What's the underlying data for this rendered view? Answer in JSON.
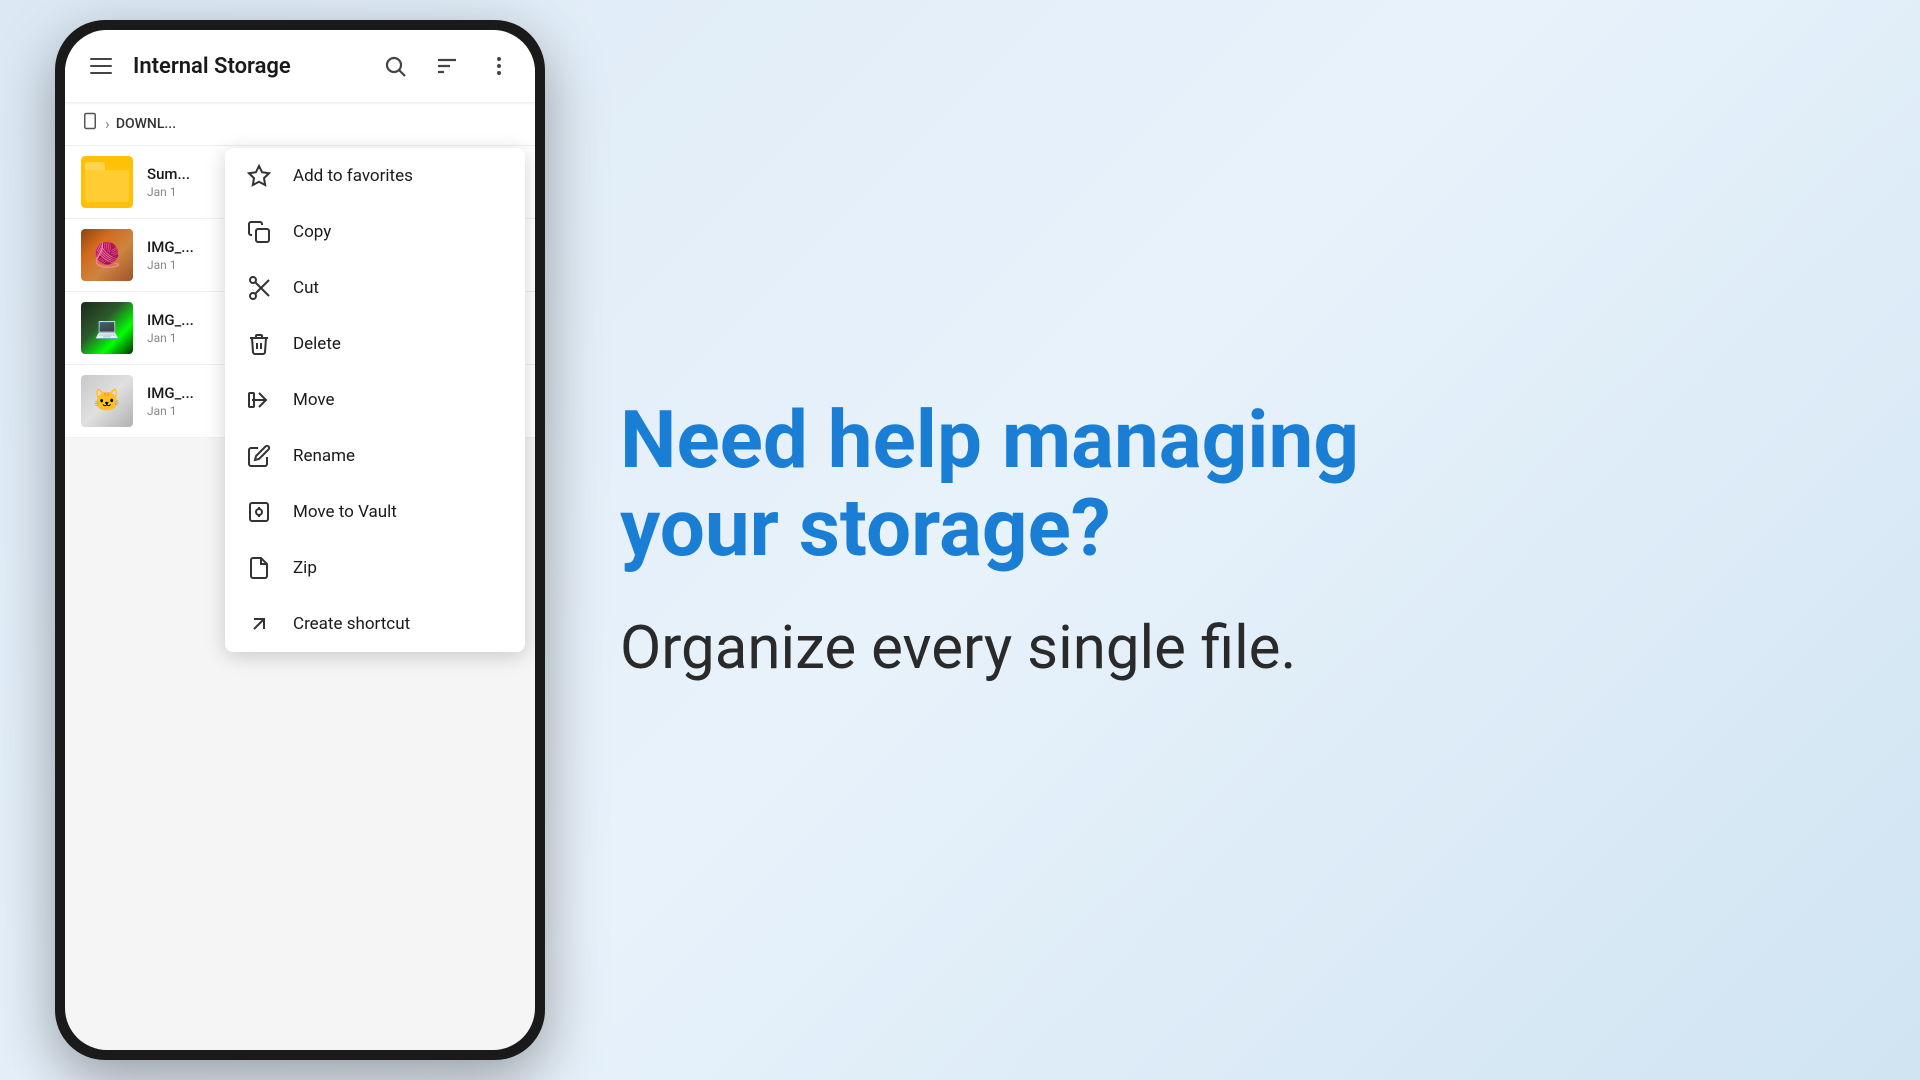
{
  "app": {
    "title": "Internal Storage",
    "breadcrumb": {
      "icon": "phone-icon",
      "separator": "›",
      "path": "DOWNL..."
    }
  },
  "toolbar": {
    "menu_icon": "hamburger-icon",
    "search_icon": "search-icon",
    "sort_icon": "sort-icon",
    "more_icon": "more-icon"
  },
  "files": [
    {
      "name": "Sum...",
      "date": "Jan 1",
      "type": "folder"
    },
    {
      "name": "IMG_...",
      "date": "Jan 1",
      "type": "image1"
    },
    {
      "name": "IMG_...",
      "date": "Jan 1",
      "type": "image2"
    },
    {
      "name": "IMG_...",
      "date": "Jan 1",
      "type": "image3"
    }
  ],
  "context_menu": {
    "items": [
      {
        "id": "add-favorites",
        "label": "Add to favorites",
        "icon": "star-icon"
      },
      {
        "id": "copy",
        "label": "Copy",
        "icon": "copy-icon"
      },
      {
        "id": "cut",
        "label": "Cut",
        "icon": "cut-icon"
      },
      {
        "id": "delete",
        "label": "Delete",
        "icon": "delete-icon"
      },
      {
        "id": "move",
        "label": "Move",
        "icon": "move-icon"
      },
      {
        "id": "rename",
        "label": "Rename",
        "icon": "rename-icon"
      },
      {
        "id": "move-to-vault",
        "label": "Move to Vault",
        "icon": "vault-icon"
      },
      {
        "id": "zip",
        "label": "Zip",
        "icon": "zip-icon"
      },
      {
        "id": "create-shortcut",
        "label": "Create shortcut",
        "icon": "shortcut-icon"
      }
    ]
  },
  "marketing": {
    "headline": "Need help managing\nyour storage?",
    "subtext": "Organize every single file."
  }
}
